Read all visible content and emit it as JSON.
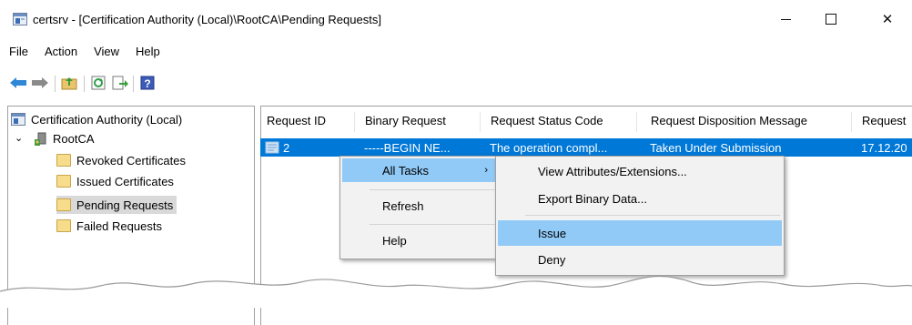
{
  "window": {
    "title": "certsrv - [Certification Authority (Local)\\RootCA\\Pending Requests]",
    "minimize_glyph": "—",
    "maximize_glyph": "☐",
    "close_glyph": "✕"
  },
  "menubar": [
    "File",
    "Action",
    "View",
    "Help"
  ],
  "toolbar": {
    "icons": [
      "back-icon",
      "forward-icon",
      "up-folder-icon",
      "refresh-icon",
      "export-list-icon",
      "help-icon"
    ]
  },
  "tree": {
    "root": "Certification Authority (Local)",
    "ca": "RootCA",
    "folders": [
      "Revoked Certificates",
      "Issued Certificates",
      "Pending Requests",
      "Failed Requests"
    ],
    "selected": "Pending Requests"
  },
  "list": {
    "columns": [
      "Request ID",
      "Binary Request",
      "Request Status Code",
      "Request Disposition Message",
      "Request"
    ],
    "rows": [
      {
        "request_id": "2",
        "binary_request": "-----BEGIN NE...",
        "status_code": "The operation compl...",
        "disposition": "Taken Under Submission",
        "request_date": "17.12.20"
      }
    ]
  },
  "context_menu": {
    "items": [
      "All Tasks",
      "Refresh",
      "Help"
    ],
    "submenu_arrow": "›"
  },
  "submenu": {
    "items": [
      "View Attributes/Extensions...",
      "Export Binary Data...",
      "Issue",
      "Deny"
    ],
    "highlighted": "Issue"
  },
  "colors": {
    "selection": "#0078d7",
    "menu_highlight": "#91c9f7",
    "tree_selected": "#d9d9d9"
  }
}
